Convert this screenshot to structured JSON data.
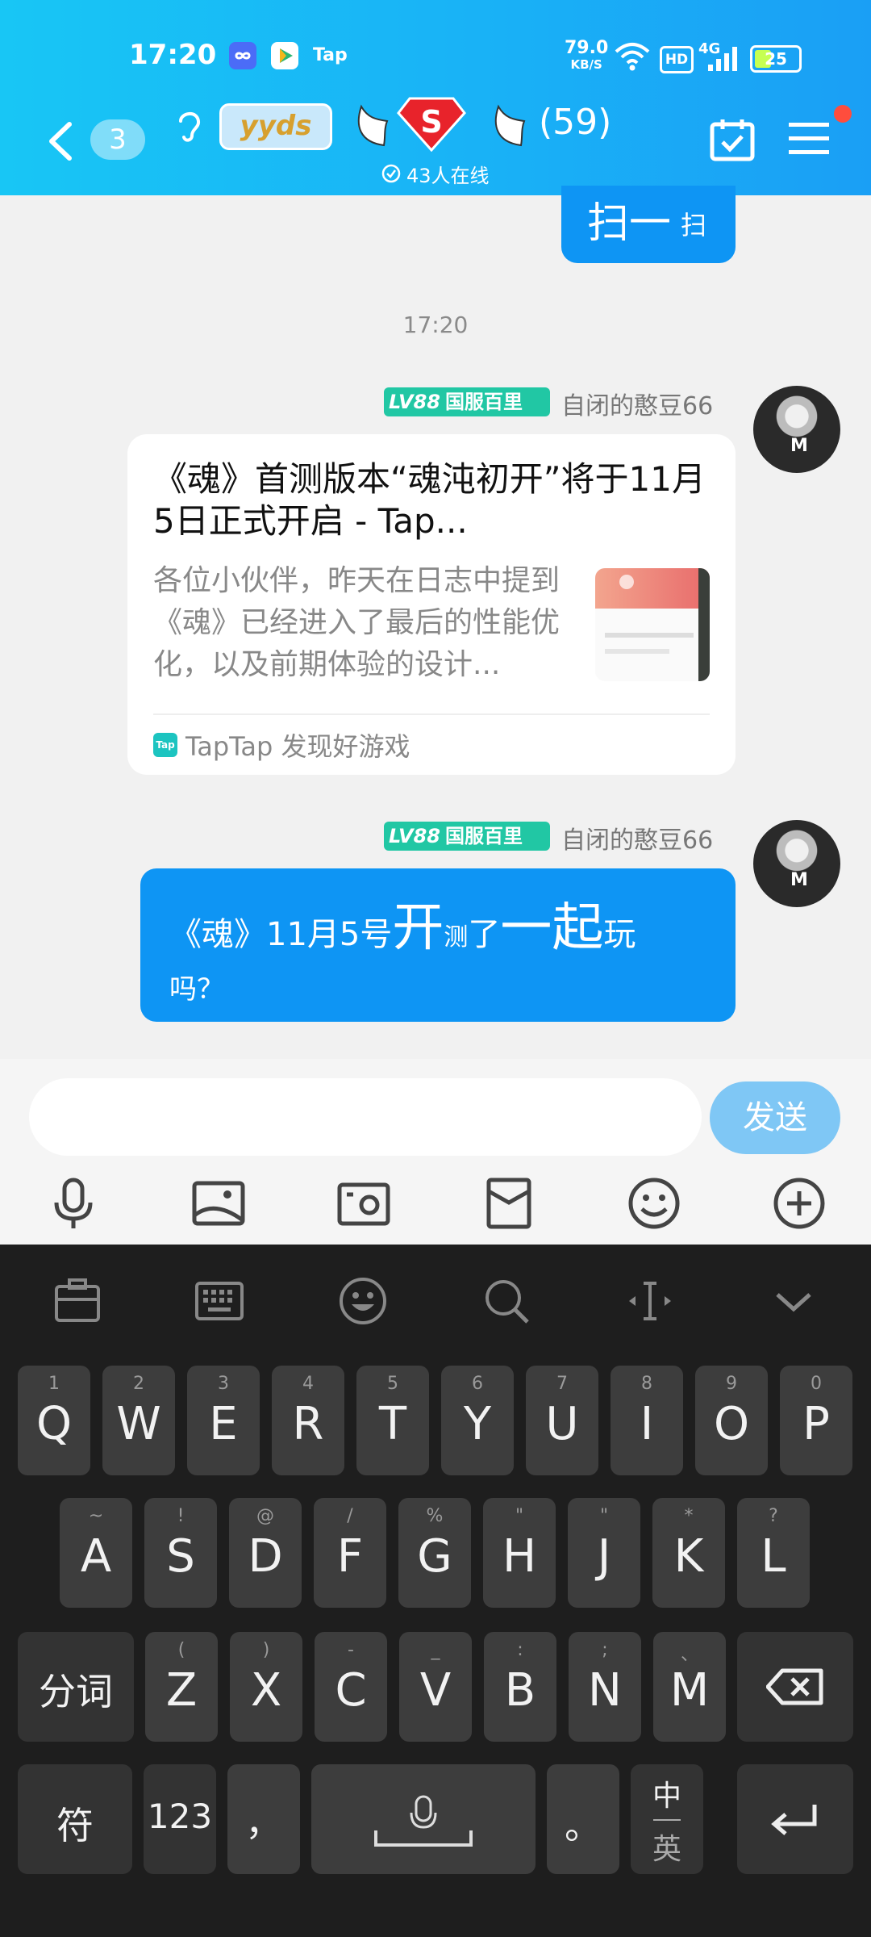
{
  "status_bar": {
    "time": "17:20",
    "app_icons": [
      "infinity-app-icon",
      "play-app-icon"
    ],
    "tap_label": "Tap",
    "net_speed_value": "79.0",
    "net_speed_unit": "KB/S",
    "hd_label": "HD",
    "network": "4G",
    "battery": "25"
  },
  "header": {
    "back_count": "3",
    "group_badge": "yyds",
    "member_count": "(59)",
    "online_text": "43人在线"
  },
  "chat": {
    "prev_bubble_big": "扫一",
    "prev_bubble_small": "扫",
    "timestamp": "17:20",
    "messages": [
      {
        "level": "LV88",
        "title_tag": "国服百里",
        "nickname": "自闭的憨豆66",
        "card": {
          "title": "《魂》首测版本“魂沌初开”将于11月5日正式开启 - Tap...",
          "description": "各位小伙伴，昨天在日志中提到《魂》已经进入了最后的性能优化，以及前期体验的设计...",
          "source": "TapTap 发现好游戏",
          "source_icon_text": "Tap"
        }
      },
      {
        "level": "LV88",
        "title_tag": "国服百里",
        "nickname": "自闭的憨豆66",
        "text_parts": [
          "《魂》11月5号",
          "开",
          "测",
          "了",
          "一起",
          "玩",
          "吗？"
        ]
      }
    ]
  },
  "input_bar": {
    "placeholder": "",
    "send_label": "发送",
    "tools": [
      "microphone-icon",
      "image-icon",
      "camera-icon",
      "red-packet-icon",
      "emoji-icon",
      "plus-icon"
    ]
  },
  "keyboard": {
    "toolbar": [
      "clipboard-icon",
      "keyboard-icon",
      "emoji-icon",
      "search-icon",
      "cursor-icon",
      "collapse-icon"
    ],
    "row1": [
      {
        "k": "Q",
        "h": "1"
      },
      {
        "k": "W",
        "h": "2"
      },
      {
        "k": "E",
        "h": "3"
      },
      {
        "k": "R",
        "h": "4"
      },
      {
        "k": "T",
        "h": "5"
      },
      {
        "k": "Y",
        "h": "6"
      },
      {
        "k": "U",
        "h": "7"
      },
      {
        "k": "I",
        "h": "8"
      },
      {
        "k": "O",
        "h": "9"
      },
      {
        "k": "P",
        "h": "0"
      }
    ],
    "row2": [
      {
        "k": "A",
        "h": "~"
      },
      {
        "k": "S",
        "h": "!"
      },
      {
        "k": "D",
        "h": "@"
      },
      {
        "k": "F",
        "h": "/"
      },
      {
        "k": "G",
        "h": "%"
      },
      {
        "k": "H",
        "h": "\""
      },
      {
        "k": "J",
        "h": "\""
      },
      {
        "k": "K",
        "h": "*"
      },
      {
        "k": "L",
        "h": "?"
      }
    ],
    "row3": [
      {
        "k": "Z",
        "h": "("
      },
      {
        "k": "X",
        "h": ")"
      },
      {
        "k": "C",
        "h": "-"
      },
      {
        "k": "V",
        "h": "_"
      },
      {
        "k": "B",
        "h": ":"
      },
      {
        "k": "N",
        "h": ";"
      },
      {
        "k": "M",
        "h": "、"
      }
    ],
    "segment_label": "分词",
    "symbol_label": "符",
    "num_label": "123",
    "comma_label": "，",
    "period_label": "。",
    "lang_top": "中",
    "lang_bottom": "英"
  }
}
